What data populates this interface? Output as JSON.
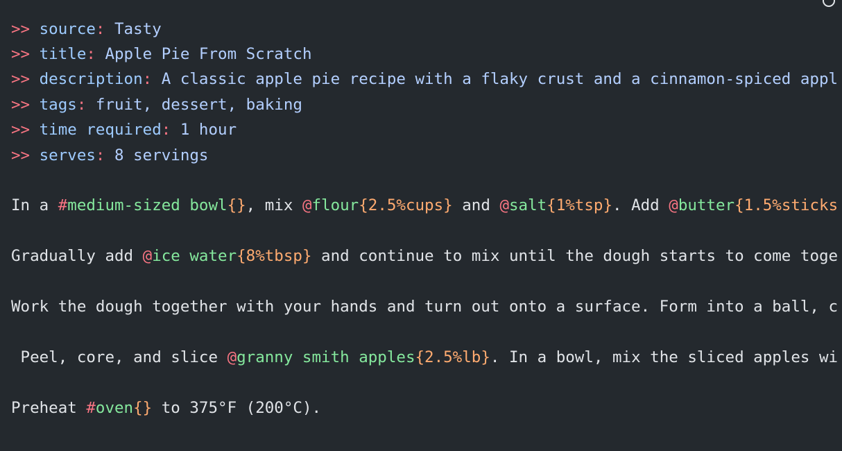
{
  "metadata": [
    {
      "prefix": ">> ",
      "key": "source",
      "colon": ": ",
      "value": "Tasty"
    },
    {
      "prefix": ">> ",
      "key": "title",
      "colon": ": ",
      "value": "Apple Pie From Scratch"
    },
    {
      "prefix": ">> ",
      "key": "description",
      "colon": ": ",
      "value": "A classic apple pie recipe with a flaky crust and a cinnamon-spiced appl"
    },
    {
      "prefix": ">> ",
      "key": "tags",
      "colon": ": ",
      "value": "fruit, dessert, baking"
    },
    {
      "prefix": ">> ",
      "key": "time required",
      "colon": ": ",
      "value": "1 hour"
    },
    {
      "prefix": ">> ",
      "key": "serves",
      "colon": ": ",
      "value": "8 servings"
    }
  ],
  "steps": {
    "step1": {
      "t1": "In a ",
      "cookware1": {
        "sigil": "#",
        "name": "medium-sized bowl",
        "open": "{",
        "close": "}"
      },
      "t2": ", mix ",
      "ing1": {
        "sigil": "@",
        "name": "flour",
        "open": "{",
        "qty": "2.5%cups",
        "close": "}"
      },
      "t3": " and ",
      "ing2": {
        "sigil": "@",
        "name": "salt",
        "open": "{",
        "qty": "1%tsp",
        "close": "}"
      },
      "t4": ". Add ",
      "ing3": {
        "sigil": "@",
        "name": "butter",
        "open": "{",
        "qty": "1.5%sticks"
      }
    },
    "step2": {
      "t1": "Gradually add ",
      "ing1": {
        "sigil": "@",
        "name": "ice water",
        "open": "{",
        "qty": "8%tbsp",
        "close": "}"
      },
      "t2": " and continue to mix until the dough starts to come toge"
    },
    "step3": {
      "t1": "Work the dough together with your hands and turn out onto a surface. Form into a ball, c"
    },
    "step4": {
      "t1": " Peel, core, and slice ",
      "ing1": {
        "sigil": "@",
        "name": "granny smith apples",
        "open": "{",
        "qty": "2.5%lb",
        "close": "}"
      },
      "t2": ". In a bowl, mix the sliced apples wi"
    },
    "step5": {
      "t1": "Preheat ",
      "cookware1": {
        "sigil": "#",
        "name": "oven",
        "open": "{",
        "close": "}"
      },
      "t2": " to 375°F (200°C)."
    }
  }
}
